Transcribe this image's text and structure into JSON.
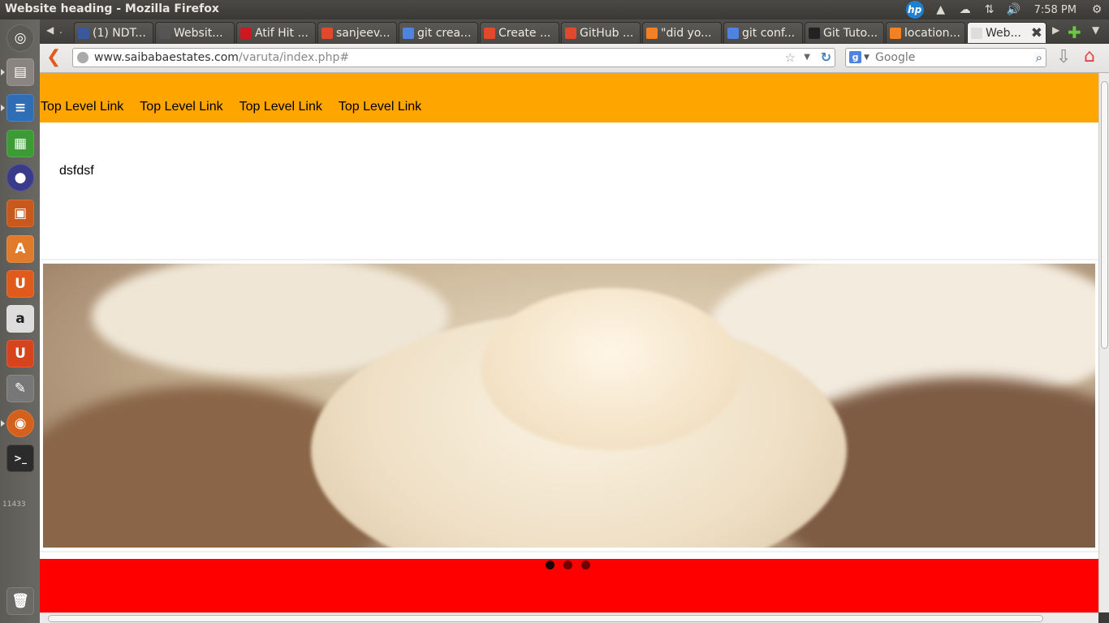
{
  "window": {
    "title": "Website heading - Mozilla Firefox"
  },
  "tray": {
    "clock": "7:58 PM"
  },
  "launcher": {
    "workspace_counter": "11433"
  },
  "tabs": [
    {
      "label": "(1) NDT...",
      "icon": "facebook-icon",
      "color": "#3b5998"
    },
    {
      "label": "Websit...",
      "icon": "page-icon",
      "color": "#555"
    },
    {
      "label": "Atif Hit ...",
      "icon": "youtube-icon",
      "color": "#cc181e"
    },
    {
      "label": "sanjeev...",
      "icon": "spinner-icon",
      "color": "#e0492b"
    },
    {
      "label": "git crea...",
      "icon": "google-icon",
      "color": "#4f83e0"
    },
    {
      "label": "Create ...",
      "icon": "spinner-icon",
      "color": "#e0492b"
    },
    {
      "label": "GitHub ...",
      "icon": "spinner-icon",
      "color": "#e0492b"
    },
    {
      "label": "\"did yo...",
      "icon": "stackoverflow-icon",
      "color": "#f48024"
    },
    {
      "label": "git conf...",
      "icon": "google-icon",
      "color": "#4f83e0"
    },
    {
      "label": "Git Tuto...",
      "icon": "github-icon",
      "color": "#222"
    },
    {
      "label": "location...",
      "icon": "stackoverflow-icon",
      "color": "#f48024"
    },
    {
      "label": "Web...",
      "icon": "page-icon",
      "color": "#ddd"
    }
  ],
  "navbar": {
    "url_host": "www.saibabaestates.com",
    "url_path": "/varuta/index.php#",
    "search_placeholder": "Google"
  },
  "page": {
    "menu": [
      "Top Level Link",
      "Top Level Link",
      "Top Level Link",
      "Top Level Link"
    ],
    "text": "dsfdsf",
    "slider_active_index": 0,
    "slider_count": 3,
    "menu_color": "#ffa500",
    "footer_color": "#ff0000"
  }
}
